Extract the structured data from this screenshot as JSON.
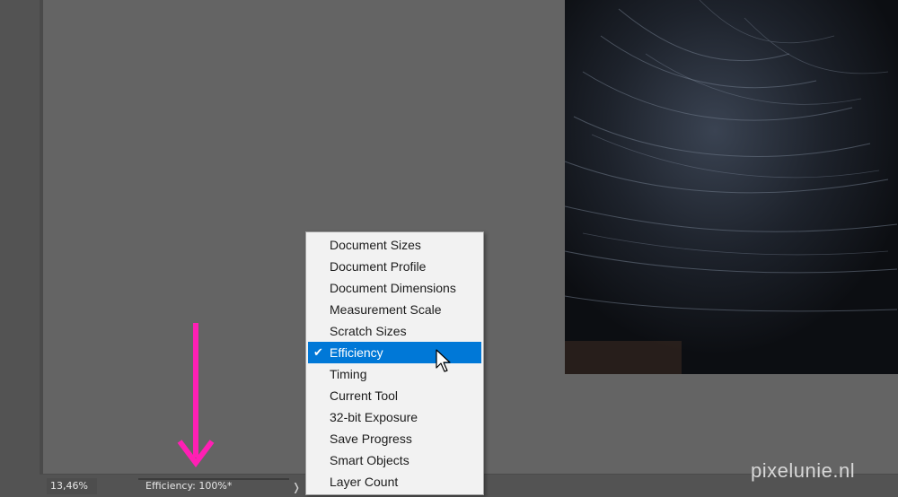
{
  "status_bar": {
    "zoom": "13,46%",
    "info": "Efficiency: 100%*",
    "menu_arrow": "❭"
  },
  "menu": {
    "items": [
      {
        "label": "Document Sizes",
        "selected": false
      },
      {
        "label": "Document Profile",
        "selected": false
      },
      {
        "label": "Document Dimensions",
        "selected": false
      },
      {
        "label": "Measurement Scale",
        "selected": false
      },
      {
        "label": "Scratch Sizes",
        "selected": false
      },
      {
        "label": "Efficiency",
        "selected": true
      },
      {
        "label": "Timing",
        "selected": false
      },
      {
        "label": "Current Tool",
        "selected": false
      },
      {
        "label": "32-bit Exposure",
        "selected": false
      },
      {
        "label": "Save Progress",
        "selected": false
      },
      {
        "label": "Smart Objects",
        "selected": false
      },
      {
        "label": "Layer Count",
        "selected": false
      }
    ],
    "check_glyph": "✔"
  },
  "watermark": "pixelunie.nl",
  "colors": {
    "annotation_arrow": "#ff1fb4",
    "selection": "#0078d7"
  },
  "icons": {
    "annotation": "down-arrow-icon",
    "cursor": "mouse-pointer-icon"
  }
}
